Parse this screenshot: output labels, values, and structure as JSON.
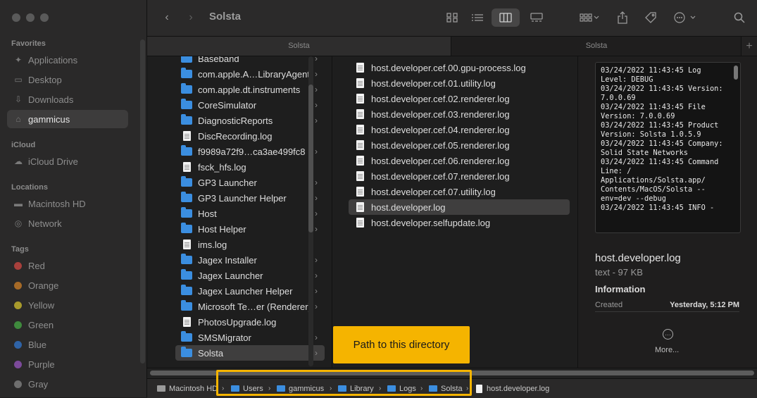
{
  "sidebar": {
    "favorites_heading": "Favorites",
    "favorites": [
      {
        "label": "Applications",
        "icon": "applications-icon"
      },
      {
        "label": "Desktop",
        "icon": "desktop-icon"
      },
      {
        "label": "Downloads",
        "icon": "downloads-icon"
      },
      {
        "label": "gammicus",
        "icon": "home-icon",
        "selected": true
      }
    ],
    "icloud_heading": "iCloud",
    "icloud": [
      {
        "label": "iCloud Drive",
        "icon": "cloud-icon"
      }
    ],
    "locations_heading": "Locations",
    "locations": [
      {
        "label": "Macintosh HD",
        "icon": "disk-icon"
      },
      {
        "label": "Network",
        "icon": "network-icon"
      }
    ],
    "tags_heading": "Tags",
    "tags": [
      {
        "label": "Red",
        "color": "#a8403c"
      },
      {
        "label": "Orange",
        "color": "#a66a27"
      },
      {
        "label": "Yellow",
        "color": "#a89a2c"
      },
      {
        "label": "Green",
        "color": "#3f8a3d"
      },
      {
        "label": "Blue",
        "color": "#2f63a6"
      },
      {
        "label": "Purple",
        "color": "#7c4a9a"
      },
      {
        "label": "Gray",
        "color": "#6e6e6e"
      }
    ]
  },
  "toolbar": {
    "title": "Solsta"
  },
  "tabs": [
    "Solsta",
    "Solsta"
  ],
  "column1": {
    "items": [
      {
        "label": "Baseband",
        "kind": "folder"
      },
      {
        "label": "com.apple.A…LibraryAgent",
        "kind": "folder"
      },
      {
        "label": "com.apple.dt.instruments",
        "kind": "folder"
      },
      {
        "label": "CoreSimulator",
        "kind": "folder"
      },
      {
        "label": "DiagnosticReports",
        "kind": "folder"
      },
      {
        "label": "DiscRecording.log",
        "kind": "file"
      },
      {
        "label": "f9989a72f9…ca3ae499fc8",
        "kind": "folder"
      },
      {
        "label": "fsck_hfs.log",
        "kind": "file"
      },
      {
        "label": "GP3 Launcher",
        "kind": "folder"
      },
      {
        "label": "GP3 Launcher Helper",
        "kind": "folder"
      },
      {
        "label": "Host",
        "kind": "folder"
      },
      {
        "label": "Host Helper",
        "kind": "folder"
      },
      {
        "label": "ims.log",
        "kind": "file"
      },
      {
        "label": "Jagex Installer",
        "kind": "folder"
      },
      {
        "label": "Jagex Launcher",
        "kind": "folder"
      },
      {
        "label": "Jagex Launcher Helper",
        "kind": "folder"
      },
      {
        "label": "Microsoft Te…er (Renderer)",
        "kind": "folder"
      },
      {
        "label": "PhotosUpgrade.log",
        "kind": "file"
      },
      {
        "label": "SMSMigrator",
        "kind": "folder"
      },
      {
        "label": "Solsta",
        "kind": "folder",
        "selected": true
      }
    ]
  },
  "column2": {
    "items": [
      {
        "label": "host.developer.cef.00.gpu-process.log"
      },
      {
        "label": "host.developer.cef.01.utility.log"
      },
      {
        "label": "host.developer.cef.02.renderer.log"
      },
      {
        "label": "host.developer.cef.03.renderer.log"
      },
      {
        "label": "host.developer.cef.04.renderer.log"
      },
      {
        "label": "host.developer.cef.05.renderer.log"
      },
      {
        "label": "host.developer.cef.06.renderer.log"
      },
      {
        "label": "host.developer.cef.07.renderer.log"
      },
      {
        "label": "host.developer.cef.07.utility.log"
      },
      {
        "label": "host.developer.log",
        "selected": true
      },
      {
        "label": "host.developer.selfupdate.log"
      }
    ]
  },
  "preview": {
    "text": "03/24/2022 11:43:45 Log Level: DEBUG\n03/24/2022 11:43:45 Version: 7.0.0.69\n03/24/2022 11:43:45 File Version: 7.0.0.69\n03/24/2022 11:43:45 Product Version: Solsta 1.0.5.9\n03/24/2022 11:43:45 Company: Solid State Networks\n03/24/2022 11:43:45 Command Line: / Applications/Solsta.app/ Contents/MacOS/Solsta --env=dev --debug\n03/24/2022 11:43:45 INFO -",
    "filename": "host.developer.log",
    "kind": "text - 97 KB",
    "info_heading": "Information",
    "created_label": "Created",
    "created_value": "Yesterday, 5:12 PM",
    "more_label": "More..."
  },
  "pathbar": {
    "items": [
      "Macintosh HD",
      "Users",
      "gammicus",
      "Library",
      "Logs",
      "Solsta",
      "host.developer.log"
    ]
  },
  "annotation": {
    "label": "Path to this directory",
    "color": "#f5b400"
  }
}
